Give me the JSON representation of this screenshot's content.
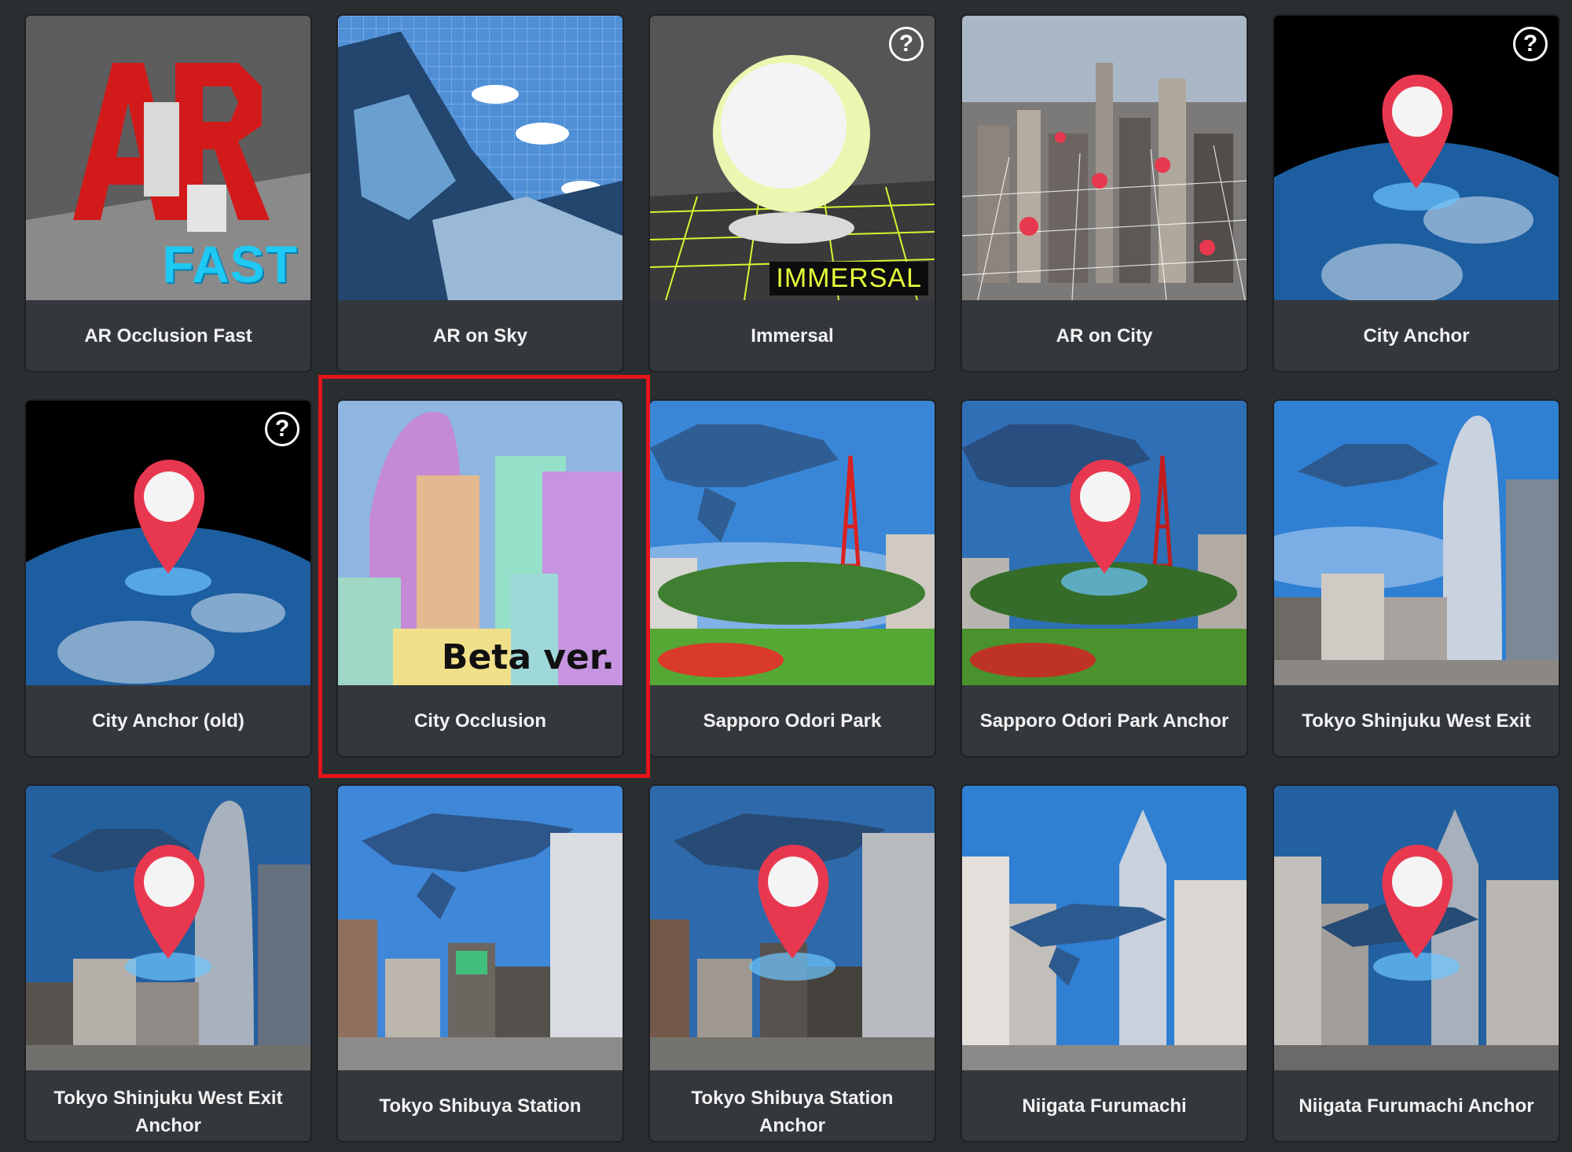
{
  "grid": {
    "cards": [
      {
        "title": "AR Occlusion Fast",
        "help": false,
        "overlay": "FAST",
        "thumb": "ar-occlusion-fast-thumbnail"
      },
      {
        "title": "AR on Sky",
        "help": false,
        "overlay": "",
        "thumb": "ar-on-sky-thumbnail"
      },
      {
        "title": "Immersal",
        "help": true,
        "overlay": "IMMERSAL",
        "thumb": "immersal-thumbnail"
      },
      {
        "title": "AR on City",
        "help": false,
        "overlay": "",
        "thumb": "ar-on-city-thumbnail"
      },
      {
        "title": "City Anchor",
        "help": true,
        "overlay": "",
        "thumb": "city-anchor-thumbnail"
      },
      {
        "title": "City Anchor (old)",
        "help": true,
        "overlay": "",
        "thumb": "city-anchor-old-thumbnail"
      },
      {
        "title": "City Occlusion",
        "help": false,
        "overlay": "Beta ver.",
        "thumb": "city-occlusion-thumbnail",
        "selected": true
      },
      {
        "title": "Sapporo Odori Park",
        "help": false,
        "overlay": "",
        "thumb": "sapporo-odori-park-thumbnail"
      },
      {
        "title": "Sapporo Odori Park Anchor",
        "help": false,
        "overlay": "",
        "thumb": "sapporo-odori-park-anchor-thumbnail"
      },
      {
        "title": "Tokyo Shinjuku West Exit",
        "help": false,
        "overlay": "",
        "thumb": "tokyo-shinjuku-west-exit-thumbnail"
      },
      {
        "title": "Tokyo Shinjuku West Exit Anchor",
        "help": false,
        "overlay": "",
        "thumb": "tokyo-shinjuku-west-exit-anchor-thumbnail"
      },
      {
        "title": "Tokyo Shibuya Station",
        "help": false,
        "overlay": "",
        "thumb": "tokyo-shibuya-station-thumbnail"
      },
      {
        "title": "Tokyo Shibuya Station Anchor",
        "help": false,
        "overlay": "",
        "thumb": "tokyo-shibuya-station-anchor-thumbnail"
      },
      {
        "title": "Niigata Furumachi",
        "help": false,
        "overlay": "",
        "thumb": "niigata-furumachi-thumbnail"
      },
      {
        "title": "Niigata Furumachi Anchor",
        "help": false,
        "overlay": "",
        "thumb": "niigata-furumachi-anchor-thumbnail"
      }
    ],
    "help_glyph": "?"
  },
  "colors": {
    "background": "#2b2e31",
    "card": "#34383c",
    "selection_outline": "#e3141b",
    "pin": "#e8384f"
  }
}
